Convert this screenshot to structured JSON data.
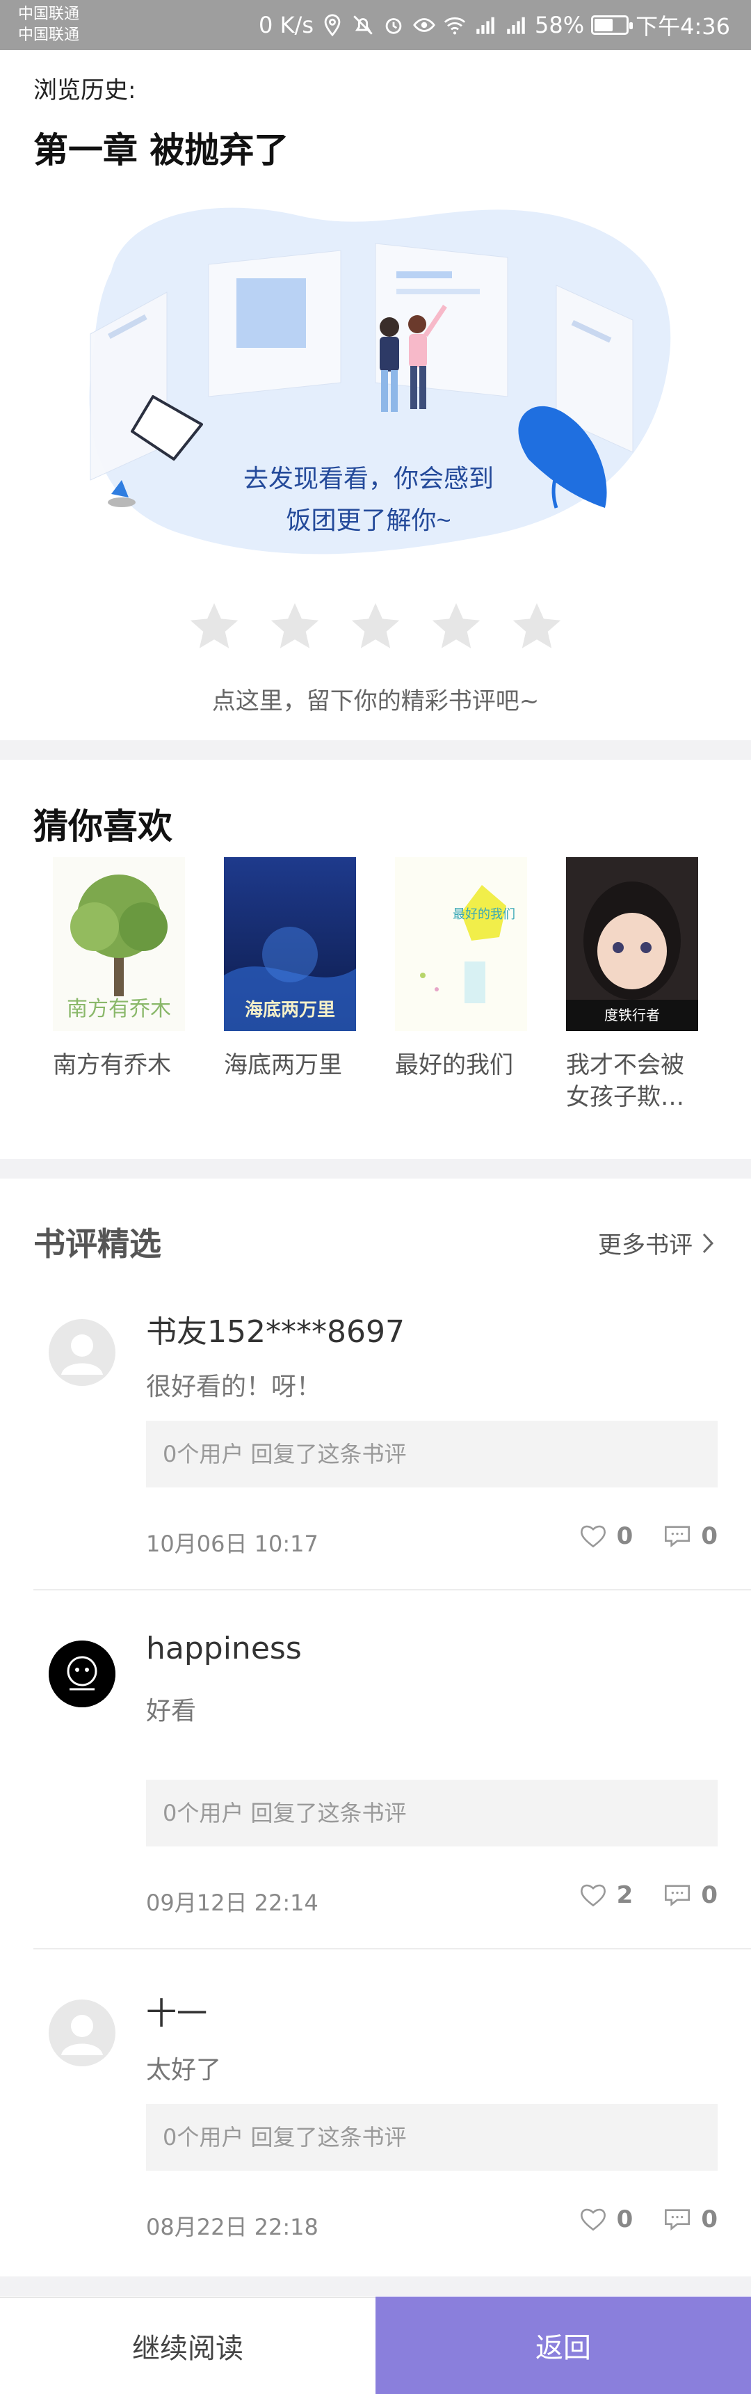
{
  "status_bar": {
    "carrier1": "中国联通",
    "carrier2": "中国联通",
    "speed": "0 K/s",
    "battery": "58%",
    "battery_level": 0.58,
    "time": "下午4:36"
  },
  "header": {
    "history_label": "浏览历史:",
    "chapter_title": "第一章 被抛弃了"
  },
  "illustration": {
    "line1": "去发现看看，你会感到",
    "line2": "饭团更了解你~"
  },
  "rating": {
    "stars_total": 5,
    "stars_filled": 0,
    "prompt": "点这里，留下你的精彩书评吧~"
  },
  "recommend": {
    "title": "猜你喜欢",
    "books": [
      {
        "name": "南方有乔木",
        "cover_text": "南方有乔木"
      },
      {
        "name": "海底两万里",
        "cover_text": "海底两万里"
      },
      {
        "name": "最好的我们",
        "cover_text": "最好的我们"
      },
      {
        "name": "我才不会被女孩子欺…",
        "cover_text": "度铁行者"
      }
    ]
  },
  "reviews_section": {
    "title": "书评精选",
    "more": "更多书评"
  },
  "reviews": [
    {
      "name": "书友152****8697",
      "text": "很好看的！呀！",
      "reply": "0个用户 回复了这条书评",
      "time": "10月06日 10:17",
      "likes": "0",
      "comments": "0"
    },
    {
      "name": "happiness",
      "text": "好看",
      "reply": "0个用户 回复了这条书评",
      "time": "09月12日 22:14",
      "likes": "2",
      "comments": "0"
    },
    {
      "name": "十一",
      "text": "太好了",
      "reply": "0个用户 回复了这条书评",
      "time": "08月22日 22:18",
      "likes": "0",
      "comments": "0"
    }
  ],
  "bottom": {
    "continue_label": "继续阅读",
    "back_label": "返回"
  },
  "colors": {
    "accent": "#8a7fdc",
    "status_bar": "#9e9e9e",
    "star_empty": "#e6e6e6"
  }
}
